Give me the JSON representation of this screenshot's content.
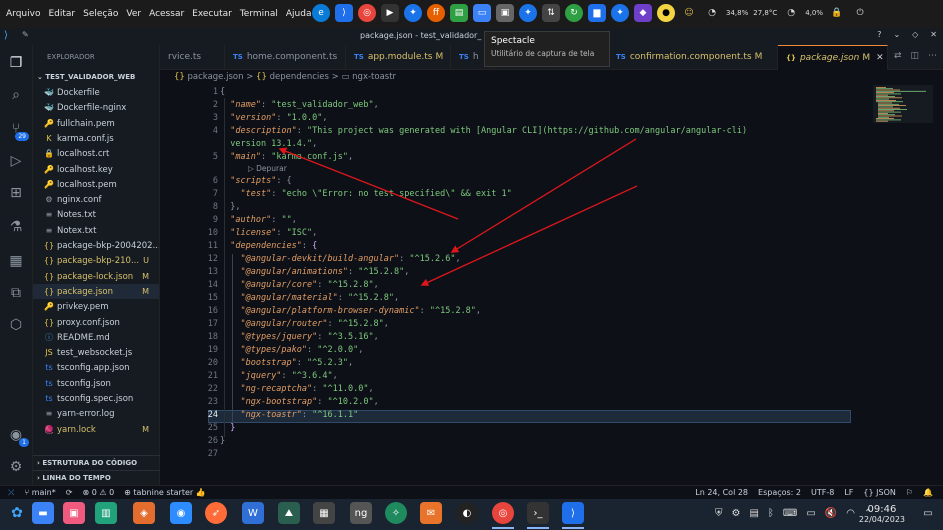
{
  "topbar": {
    "menu": [
      "Arquivo",
      "Editar",
      "Seleção",
      "Ver",
      "Acessar",
      "Executar",
      "Terminal",
      "Ajuda"
    ],
    "tray_percent_1": "34,8%",
    "tray_temp": "27,8°C",
    "tray_percent_2": "4,0%"
  },
  "window": {
    "title": "package.json - test_validador_"
  },
  "tooltip": {
    "title": "Spectacle",
    "subtitle": "Utilitário de captura de tela"
  },
  "sidebar": {
    "header": "EXPLORADOR",
    "project": "TEST_VALIDADOR_WEB",
    "files": [
      {
        "name": "Dockerfile",
        "icon": "🐳",
        "color": "#3b9ad9",
        "status": "",
        "modified": false
      },
      {
        "name": "Dockerfile-nginx",
        "icon": "🐳",
        "color": "#3b9ad9",
        "status": "",
        "modified": false
      },
      {
        "name": "fullchain.pem",
        "icon": "🔑",
        "color": "#d6a64d",
        "status": "",
        "modified": false
      },
      {
        "name": "karma.conf.js",
        "icon": "K",
        "color": "#e0c14b",
        "status": "",
        "modified": false
      },
      {
        "name": "localhost.crt",
        "icon": "🔒",
        "color": "#d6a64d",
        "status": "",
        "modified": false
      },
      {
        "name": "localhost.key",
        "icon": "🔑",
        "color": "#d6a64d",
        "status": "",
        "modified": false
      },
      {
        "name": "localhost.pem",
        "icon": "🔑",
        "color": "#d6a64d",
        "status": "",
        "modified": false
      },
      {
        "name": "nginx.conf",
        "icon": "⚙",
        "color": "#9aa0a6",
        "status": "",
        "modified": false
      },
      {
        "name": "Notes.txt",
        "icon": "≡",
        "color": "#9aa0a6",
        "status": "",
        "modified": false
      },
      {
        "name": "Notex.txt",
        "icon": "≡",
        "color": "#9aa0a6",
        "status": "",
        "modified": false
      },
      {
        "name": "package-bkp-2004202...",
        "icon": "{}",
        "color": "#e0c14b",
        "status": "",
        "modified": false
      },
      {
        "name": "package-bkp-210...",
        "icon": "{}",
        "color": "#e0c14b",
        "status": "U",
        "modified": true
      },
      {
        "name": "package-lock.json",
        "icon": "{}",
        "color": "#e0c14b",
        "status": "M",
        "modified": true
      },
      {
        "name": "package.json",
        "icon": "{}",
        "color": "#e0c14b",
        "status": "M",
        "modified": true
      },
      {
        "name": "privkey.pem",
        "icon": "🔑",
        "color": "#d6a64d",
        "status": "",
        "modified": false
      },
      {
        "name": "proxy.conf.json",
        "icon": "{}",
        "color": "#e0c14b",
        "status": "",
        "modified": false
      },
      {
        "name": "README.md",
        "icon": "ⓘ",
        "color": "#3b9ad9",
        "status": "",
        "modified": false
      },
      {
        "name": "test_websocket.js",
        "icon": "JS",
        "color": "#e0c14b",
        "status": "",
        "modified": false
      },
      {
        "name": "tsconfig.app.json",
        "icon": "ts",
        "color": "#3b82f6",
        "status": "",
        "modified": false
      },
      {
        "name": "tsconfig.json",
        "icon": "ts",
        "color": "#3b82f6",
        "status": "",
        "modified": false
      },
      {
        "name": "tsconfig.spec.json",
        "icon": "ts",
        "color": "#3b82f6",
        "status": "",
        "modified": false
      },
      {
        "name": "yarn-error.log",
        "icon": "≡",
        "color": "#9aa0a6",
        "status": "",
        "modified": false
      },
      {
        "name": "yarn.lock",
        "icon": "🧶",
        "color": "#3b9ad9",
        "status": "M",
        "modified": true
      }
    ],
    "outline": "ESTRUTURA DO CÓDIGO",
    "timeline": "LINHA DO TEMPO"
  },
  "tabs": [
    {
      "icon": "",
      "label": "rvice.ts",
      "mark": ""
    },
    {
      "icon": "TS",
      "label": "home.component.ts",
      "mark": ""
    },
    {
      "icon": "TS",
      "label": "app.module.ts",
      "mark": "M"
    },
    {
      "icon": "TS",
      "label": "h",
      "mark": ""
    },
    {
      "icon": "TS",
      "label": "confirmation.component.ts",
      "mark": "M"
    },
    {
      "icon": "{}",
      "label": "package.json",
      "mark": "M"
    }
  ],
  "breadcrumb": {
    "p1": "package.json",
    "p2": "dependencies",
    "p3": "ngx-toastr",
    "sep": ">"
  },
  "codelens": "▷ Depurar",
  "code_lines": [
    {
      "n": "1",
      "t": [
        [
          "g",
          "{"
        ]
      ]
    },
    {
      "n": "2",
      "t": [
        [
          "g",
          "  "
        ],
        [
          "k",
          "\"name\""
        ],
        [
          "g",
          ": "
        ],
        [
          "s",
          "\"test_validador_web\""
        ],
        [
          "g",
          ","
        ]
      ]
    },
    {
      "n": "3",
      "t": [
        [
          "g",
          "  "
        ],
        [
          "k",
          "\"version\""
        ],
        [
          "g",
          ": "
        ],
        [
          "s",
          "\"1.0.0\""
        ],
        [
          "g",
          ","
        ]
      ]
    },
    {
      "n": "4",
      "t": [
        [
          "g",
          "  "
        ],
        [
          "k",
          "\"description\""
        ],
        [
          "g",
          ": "
        ],
        [
          "s",
          "\"This project was generated with [Angular CLI](https://github.com/angular/angular-cli)"
        ]
      ]
    },
    {
      "n": "",
      "t": [
        [
          "s",
          "  version 13.1.4.\""
        ],
        [
          "g",
          ","
        ]
      ]
    },
    {
      "n": "5",
      "t": [
        [
          "g",
          "  "
        ],
        [
          "k",
          "\"main\""
        ],
        [
          "g",
          ": "
        ],
        [
          "s",
          "\"karma.conf.js\""
        ],
        [
          "g",
          ","
        ]
      ]
    },
    {
      "n": "6",
      "t": [
        [
          "g",
          "  "
        ],
        [
          "k",
          "\"scripts\""
        ],
        [
          "g",
          ": {"
        ]
      ]
    },
    {
      "n": "7",
      "t": [
        [
          "g",
          "    "
        ],
        [
          "k",
          "\"test\""
        ],
        [
          "g",
          ": "
        ],
        [
          "s",
          "\"echo \\\"Error: no test specified\\\" && exit 1\""
        ]
      ]
    },
    {
      "n": "8",
      "t": [
        [
          "g",
          "  },"
        ]
      ]
    },
    {
      "n": "9",
      "t": [
        [
          "g",
          "  "
        ],
        [
          "k",
          "\"author\""
        ],
        [
          "g",
          ": "
        ],
        [
          "s",
          "\"\""
        ],
        [
          "g",
          ","
        ]
      ]
    },
    {
      "n": "10",
      "t": [
        [
          "g",
          "  "
        ],
        [
          "k",
          "\"license\""
        ],
        [
          "g",
          ": "
        ],
        [
          "s",
          "\"ISC\""
        ],
        [
          "g",
          ","
        ]
      ]
    },
    {
      "n": "11",
      "t": [
        [
          "g",
          "  "
        ],
        [
          "k",
          "\"dependencies\""
        ],
        [
          "g",
          ": "
        ],
        [
          "p",
          "{"
        ]
      ]
    },
    {
      "n": "12",
      "t": [
        [
          "g",
          "    "
        ],
        [
          "k",
          "\"@angular-devkit/build-angular\""
        ],
        [
          "g",
          ": "
        ],
        [
          "s",
          "\"^15.2.6\""
        ],
        [
          "g",
          ","
        ]
      ]
    },
    {
      "n": "13",
      "t": [
        [
          "g",
          "    "
        ],
        [
          "k",
          "\"@angular/animations\""
        ],
        [
          "g",
          ": "
        ],
        [
          "s",
          "\"^15.2.8\""
        ],
        [
          "g",
          ","
        ]
      ]
    },
    {
      "n": "14",
      "t": [
        [
          "g",
          "    "
        ],
        [
          "k",
          "\"@angular/core\""
        ],
        [
          "g",
          ": "
        ],
        [
          "s",
          "\"^15.2.8\""
        ],
        [
          "g",
          ","
        ]
      ]
    },
    {
      "n": "15",
      "t": [
        [
          "g",
          "    "
        ],
        [
          "k",
          "\"@angular/material\""
        ],
        [
          "g",
          ": "
        ],
        [
          "s",
          "\"^15.2.8\""
        ],
        [
          "g",
          ","
        ]
      ]
    },
    {
      "n": "16",
      "t": [
        [
          "g",
          "    "
        ],
        [
          "k",
          "\"@angular/platform-browser-dynamic\""
        ],
        [
          "g",
          ": "
        ],
        [
          "s",
          "\"^15.2.8\""
        ],
        [
          "g",
          ","
        ]
      ]
    },
    {
      "n": "17",
      "t": [
        [
          "g",
          "    "
        ],
        [
          "k",
          "\"@angular/router\""
        ],
        [
          "g",
          ": "
        ],
        [
          "s",
          "\"^15.2.8\""
        ],
        [
          "g",
          ","
        ]
      ]
    },
    {
      "n": "18",
      "t": [
        [
          "g",
          "    "
        ],
        [
          "k",
          "\"@types/jquery\""
        ],
        [
          "g",
          ": "
        ],
        [
          "s",
          "\"^3.5.16\""
        ],
        [
          "g",
          ","
        ]
      ]
    },
    {
      "n": "19",
      "t": [
        [
          "g",
          "    "
        ],
        [
          "k",
          "\"@types/pako\""
        ],
        [
          "g",
          ": "
        ],
        [
          "s",
          "\"^2.0.0\""
        ],
        [
          "g",
          ","
        ]
      ]
    },
    {
      "n": "20",
      "t": [
        [
          "g",
          "    "
        ],
        [
          "k",
          "\"bootstrap\""
        ],
        [
          "g",
          ": "
        ],
        [
          "s",
          "\"^5.2.3\""
        ],
        [
          "g",
          ","
        ]
      ]
    },
    {
      "n": "21",
      "t": [
        [
          "g",
          "    "
        ],
        [
          "k",
          "\"jquery\""
        ],
        [
          "g",
          ": "
        ],
        [
          "s",
          "\"^3.6.4\""
        ],
        [
          "g",
          ","
        ]
      ]
    },
    {
      "n": "22",
      "t": [
        [
          "g",
          "    "
        ],
        [
          "k",
          "\"ng-recaptcha\""
        ],
        [
          "g",
          ": "
        ],
        [
          "s",
          "\"^11.0.0\""
        ],
        [
          "g",
          ","
        ]
      ]
    },
    {
      "n": "23",
      "t": [
        [
          "g",
          "    "
        ],
        [
          "k",
          "\"ngx-bootstrap\""
        ],
        [
          "g",
          ": "
        ],
        [
          "s",
          "\"^10.2.0\""
        ],
        [
          "g",
          ","
        ]
      ]
    },
    {
      "n": "24",
      "t": [
        [
          "g",
          "    "
        ],
        [
          "k",
          "\"ngx-toastr\""
        ],
        [
          "g",
          ": "
        ],
        [
          "s",
          "\"^16.1.1\""
        ]
      ]
    },
    {
      "n": "25",
      "t": [
        [
          "g",
          "  "
        ],
        [
          "p",
          "}"
        ]
      ]
    },
    {
      "n": "26",
      "t": [
        [
          "g",
          "}"
        ]
      ]
    },
    {
      "n": "27",
      "t": []
    }
  ],
  "status": {
    "branch": "main*",
    "errors": "0",
    "warnings": "0",
    "tabnine": "tabnine starter",
    "position": "Ln 24, Col 28",
    "spaces": "Espaços: 2",
    "encoding": "UTF-8",
    "eol": "LF",
    "language": "{} JSON"
  },
  "clock": {
    "time": "09:46",
    "date": "22/04/2023"
  },
  "annotation_color": "#e0161b"
}
